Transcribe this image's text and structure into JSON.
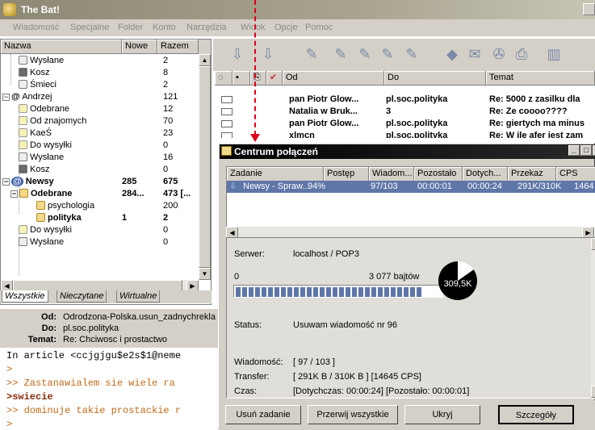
{
  "app": {
    "title": "The Bat!"
  },
  "menu": [
    "Wiadomość",
    "Specjalne",
    "Folder",
    "Konto",
    "Narzędzia",
    "Widok",
    "Opcje",
    "Pomoc"
  ],
  "folders": {
    "columns": {
      "name": "Nazwa",
      "new": "Nowe",
      "total": "Razem"
    },
    "rows": [
      {
        "name": "Wysłane",
        "new": "",
        "total": "2"
      },
      {
        "name": "Kosz",
        "new": "",
        "total": "8"
      },
      {
        "name": "Śmieci",
        "new": "",
        "total": "2"
      },
      {
        "name": "Andrzej",
        "new": "",
        "total": "121"
      },
      {
        "name": "Odebrane",
        "new": "",
        "total": "12"
      },
      {
        "name": "Od znajomych",
        "new": "",
        "total": "70"
      },
      {
        "name": "KaeŚ",
        "new": "",
        "total": "23"
      },
      {
        "name": "Do wysyłki",
        "new": "",
        "total": "0"
      },
      {
        "name": "Wysłane",
        "new": "",
        "total": "16"
      },
      {
        "name": "Kosz",
        "new": "",
        "total": "0"
      },
      {
        "name": "Newsy",
        "new": "285",
        "total": "675"
      },
      {
        "name": "Odebrane",
        "new": "284...",
        "total": "473 [..."
      },
      {
        "name": "psychologia",
        "new": "",
        "total": "200"
      },
      {
        "name": "polityka",
        "new": "1",
        "total": "2"
      },
      {
        "name": "Do wysyłki",
        "new": "",
        "total": "0"
      },
      {
        "name": "Wysłane",
        "new": "",
        "total": "0"
      }
    ],
    "tabs": [
      "Wszystkie",
      "Nieczytane",
      "Wirtualne"
    ]
  },
  "message_header": {
    "from_label": "Od:",
    "from": "Odrodzona-Polska.usun_zadnychrekla",
    "to_label": "Do:",
    "to": "pl.soc.polityka",
    "subject_label": "Temat:",
    "subject": "Re: Chciwosc i prostactwo"
  },
  "message_body": [
    "In article <ccjgjgu$e2s$1@neme",
    ">",
    ">> Zastanawialem sie wiele ra",
    ">swiecie",
    ">> dominuje takie prostackie r",
    ">"
  ],
  "message_list": {
    "columns": {
      "from": "Od",
      "to": "Do",
      "subject": "Temat"
    },
    "rows": [
      {
        "from": "pan Piotr Glow...",
        "to": "pl.soc.polityka",
        "subject": "Re: 5000 z zasilku dla"
      },
      {
        "from": "Natalia w Bruk...",
        "to": "3",
        "subject": "Re: Ze coooo????"
      },
      {
        "from": "pan Piotr Glow...",
        "to": "pl.soc.polityka",
        "subject": "Re: giertych ma minus"
      },
      {
        "from": "xlmcn",
        "to": "pl.soc.polityka",
        "subject": "Re: W ile afer jest zam"
      }
    ]
  },
  "dialog": {
    "title": "Centrum połączeń",
    "columns": [
      "Zadanie",
      "Postęp",
      "Wiadom...",
      "Pozostało",
      "Dotych...",
      "Przekaz",
      "CPS"
    ],
    "task": {
      "name": "Newsy - Spraw...",
      "progress": "94%",
      "messages": "97/103",
      "remaining": "00:00:01",
      "elapsed": "00:00:24",
      "transfer": "291K/310K",
      "cps": "1464"
    },
    "server_label": "Serwer:",
    "server": "localhost / POP3",
    "bytes_start": "0",
    "bytes_total": "3 077 bajtów",
    "progress_fraction": 0.94,
    "pie_label": "309,5K",
    "status_label": "Status:",
    "status": "Usuwam wiadomość nr 96",
    "messages_label": "Wiadomość:",
    "messages": "[ 97 / 103 ]",
    "transfer_label": "Transfer:",
    "transfer": "[ 291K B / 310K B ] [14645 CPS]",
    "time_label": "Czas:",
    "time": "[Dotychczas: 00:00:24] [Pozostało: 00:00:01]",
    "buttons": {
      "remove": "Usuń zadanie",
      "abort_all": "Przerwij wszystkie",
      "hide": "Ukryj",
      "details": "Szczegóły"
    }
  },
  "colors": {
    "accent": "#5f76a8",
    "arrow": "#e0001a"
  }
}
